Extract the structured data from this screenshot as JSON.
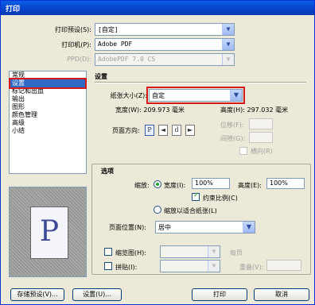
{
  "title": "打印",
  "preset": {
    "label": "打印预设(S):",
    "value": "[自定]"
  },
  "printer": {
    "label": "打印机(P):",
    "value": "Adobe PDF"
  },
  "ppd": {
    "label": "PPD(D):",
    "value": "AdobePDF 7.0 CS"
  },
  "categories": [
    "常规",
    "设置",
    "标记和出血",
    "输出",
    "图形",
    "颜色管理",
    "高级",
    "小结"
  ],
  "selected_category": "设置",
  "settings": {
    "heading": "设置",
    "paper_size_label": "纸张大小(Z):",
    "paper_size_value": "自定",
    "width_label": "宽度(W): 209.973 毫米",
    "height_label": "高度(H): 297.032 毫米",
    "orientation_label": "页面方向:",
    "offset_label": "位移(F):",
    "gap_label": "间隙(G):",
    "transverse_label": "横向(R)"
  },
  "options": {
    "heading": "选项",
    "scale_label": "缩放:",
    "width_radio_label": "宽度(I):",
    "width_value": "100%",
    "height_label": "高度(E):",
    "height_value": "100%",
    "constrain_label": "约束比例(C)",
    "fit_label": "缩放以适合纸张(L)",
    "position_label": "页面位置(N):",
    "position_value": "居中",
    "thumbnail_label": "缩览图(H):",
    "thumbnail_suffix": "每页",
    "tile_label": "拼贴(I):",
    "overlap_label": "重叠(V):"
  },
  "preview": {
    "letter": "P"
  },
  "buttons": {
    "save_preset": "存储预设(V)...",
    "setup": "设置(U)...",
    "print": "打印",
    "cancel": "取消"
  },
  "colors": {
    "titlebar": "#0a5fe4",
    "highlight": "#316ac5",
    "annotation": "#d41a1a"
  }
}
